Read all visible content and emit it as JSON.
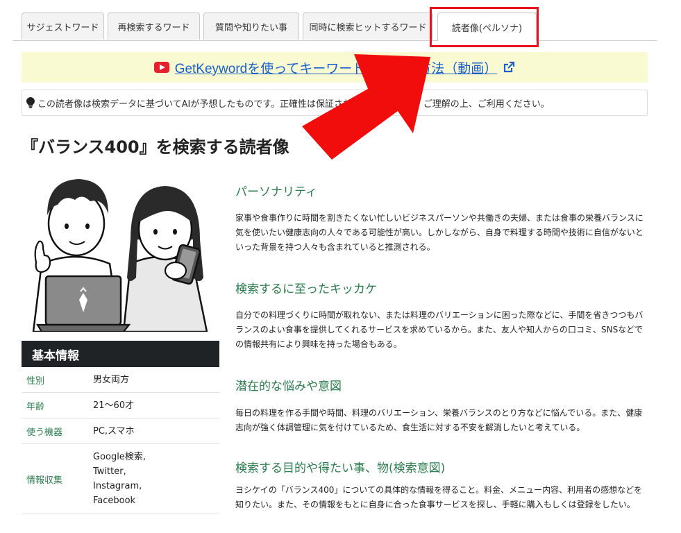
{
  "tabs": [
    {
      "label": "サジェストワード",
      "active": false
    },
    {
      "label": "再検索するワード",
      "active": false
    },
    {
      "label": "質問や知りたい事",
      "active": false
    },
    {
      "label": "同時に検索ヒットするワード",
      "active": false
    },
    {
      "label": "読者像(ペルソナ)",
      "active": true
    }
  ],
  "banner": {
    "link_text": "GetKeywordを使ってキーワード選定する方法（動画）"
  },
  "notice": {
    "text": "この読者像は検索データに基づいてAIが予想したものです。正確性は保証されていませんので、ご理解の上、ご利用ください。"
  },
  "page_title": "『バランス400』を検索する読者像",
  "basic_info": {
    "header": "基本情報",
    "rows": [
      {
        "key": "性別",
        "value": "男女両方"
      },
      {
        "key": "年齢",
        "value": "21〜60才"
      },
      {
        "key": "使う機器",
        "value": "PC,スマホ"
      },
      {
        "key": "情報収集",
        "value": "Google検索,\nTwitter,\nInstagram,\nFacebook"
      }
    ]
  },
  "sections": [
    {
      "heading": "パーソナリティ",
      "body": "家事や食事作りに時間を割きたくない忙しいビジネスパーソンや共働きの夫婦、または食事の栄養バランスに気を使いたい健康志向の人々である可能性が高い。しかしながら、自身で料理する時間や技術に自信がないといった背景を持つ人々も含まれていると推測される。"
    },
    {
      "heading": "検索するに至ったキッカケ",
      "body": "自分での料理づくりに時間が取れない、または料理のバリエーションに困った際などに、手間を省きつつもバランスのよい食事を提供してくれるサービスを求めているから。また、友人や知人からの口コミ、SNSなどでの情報共有により興味を持った場合もある。"
    },
    {
      "heading": "潜在的な悩みや意図",
      "body": "毎日の料理を作る手間や時間、料理のバリエーション、栄養バランスのとり方などに悩んでいる。また、健康志向が強く体調管理に気を付けているため、食生活に対する不安を解消したいと考えている。"
    },
    {
      "heading": "検索する目的や得たい事、物(検索意図)",
      "body": "ヨシケイの「バランス400」についての具体的な情報を得ること。料金、メニュー内容、利用者の感想などを知りたい。また、その情報をもとに自身に合った食事サービスを探し、手軽に購入もしくは登録をしたい。"
    }
  ],
  "colors": {
    "accent_green": "#2e7d4f",
    "link_blue": "#1a60c8",
    "highlight_red": "#e6131f",
    "banner_bg": "#fafad2",
    "dark_header": "#202326"
  }
}
